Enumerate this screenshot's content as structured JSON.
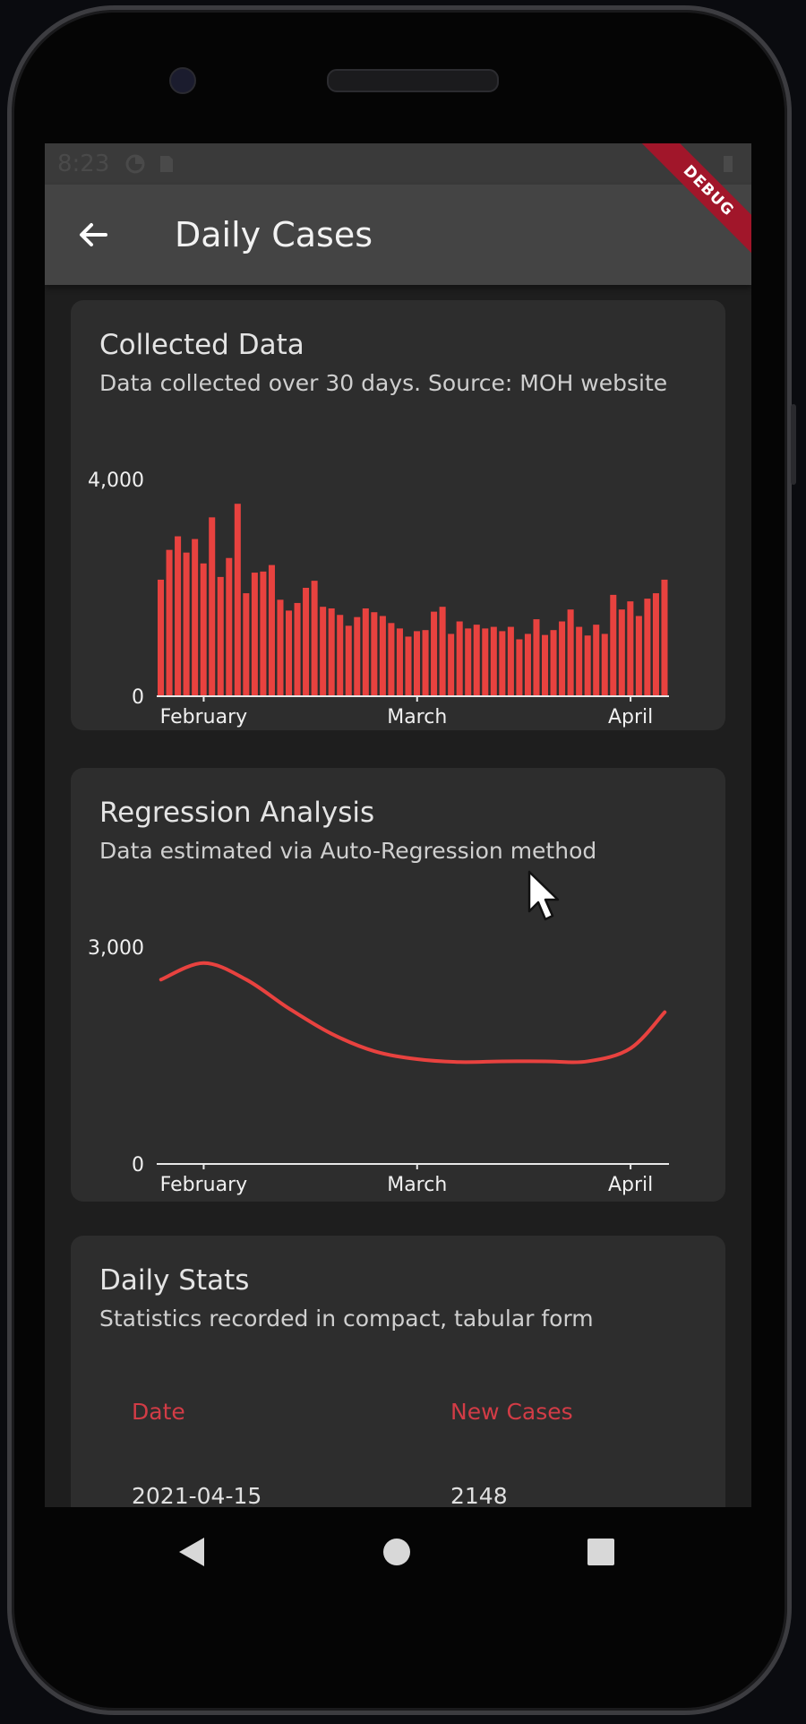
{
  "status_bar": {
    "time": "8:23"
  },
  "debug_banner": "DEBUG",
  "app_bar": {
    "title": "Daily Cases"
  },
  "collected_card": {
    "title": "Collected Data",
    "subtitle": "Data collected over 30 days. Source: MOH website"
  },
  "regression_card": {
    "title": "Regression Analysis",
    "subtitle": "Data estimated via Auto-Regression method"
  },
  "stats_card": {
    "title": "Daily Stats",
    "subtitle": "Statistics recorded in compact, tabular form",
    "columns": [
      "Date",
      "New Cases"
    ],
    "rows": [
      {
        "date": "2021-04-15",
        "new_cases": "2148"
      }
    ]
  },
  "colors": {
    "accent": "#e8423f",
    "header_text": "#d23c46",
    "card_bg": "#2d2d2d",
    "app_bar_bg": "#444444"
  },
  "chart_data": [
    {
      "type": "bar",
      "title": "Collected Data",
      "ylim": [
        0,
        4000
      ],
      "y_ticks": [
        "0",
        "4,000"
      ],
      "x_ticks": [
        "February",
        "March",
        "April"
      ],
      "x_tick_index": [
        5,
        30,
        55
      ],
      "values": [
        2150,
        2700,
        2950,
        2650,
        2900,
        2450,
        3300,
        2200,
        2550,
        3550,
        1900,
        2280,
        2300,
        2420,
        1780,
        1580,
        1720,
        2000,
        2130,
        1650,
        1620,
        1500,
        1300,
        1460,
        1620,
        1550,
        1480,
        1350,
        1250,
        1100,
        1200,
        1220,
        1560,
        1650,
        1150,
        1380,
        1250,
        1320,
        1250,
        1280,
        1200,
        1280,
        1050,
        1150,
        1420,
        1130,
        1220,
        1380,
        1600,
        1280,
        1120,
        1320,
        1150,
        1870,
        1600,
        1750,
        1480,
        1800,
        1900,
        2150
      ]
    },
    {
      "type": "line",
      "title": "Regression Analysis",
      "ylim": [
        0,
        3000
      ],
      "y_ticks": [
        "0",
        "3,000"
      ],
      "x_ticks": [
        "February",
        "March",
        "April"
      ],
      "x_tick_index": [
        5,
        30,
        55
      ],
      "x_count": 60,
      "series": [
        {
          "x": [
            0,
            5,
            10,
            15,
            20,
            25,
            30,
            35,
            40,
            45,
            50,
            55,
            59
          ],
          "values": [
            2550,
            2780,
            2550,
            2150,
            1800,
            1560,
            1450,
            1410,
            1420,
            1420,
            1420,
            1600,
            2100
          ]
        }
      ]
    }
  ]
}
